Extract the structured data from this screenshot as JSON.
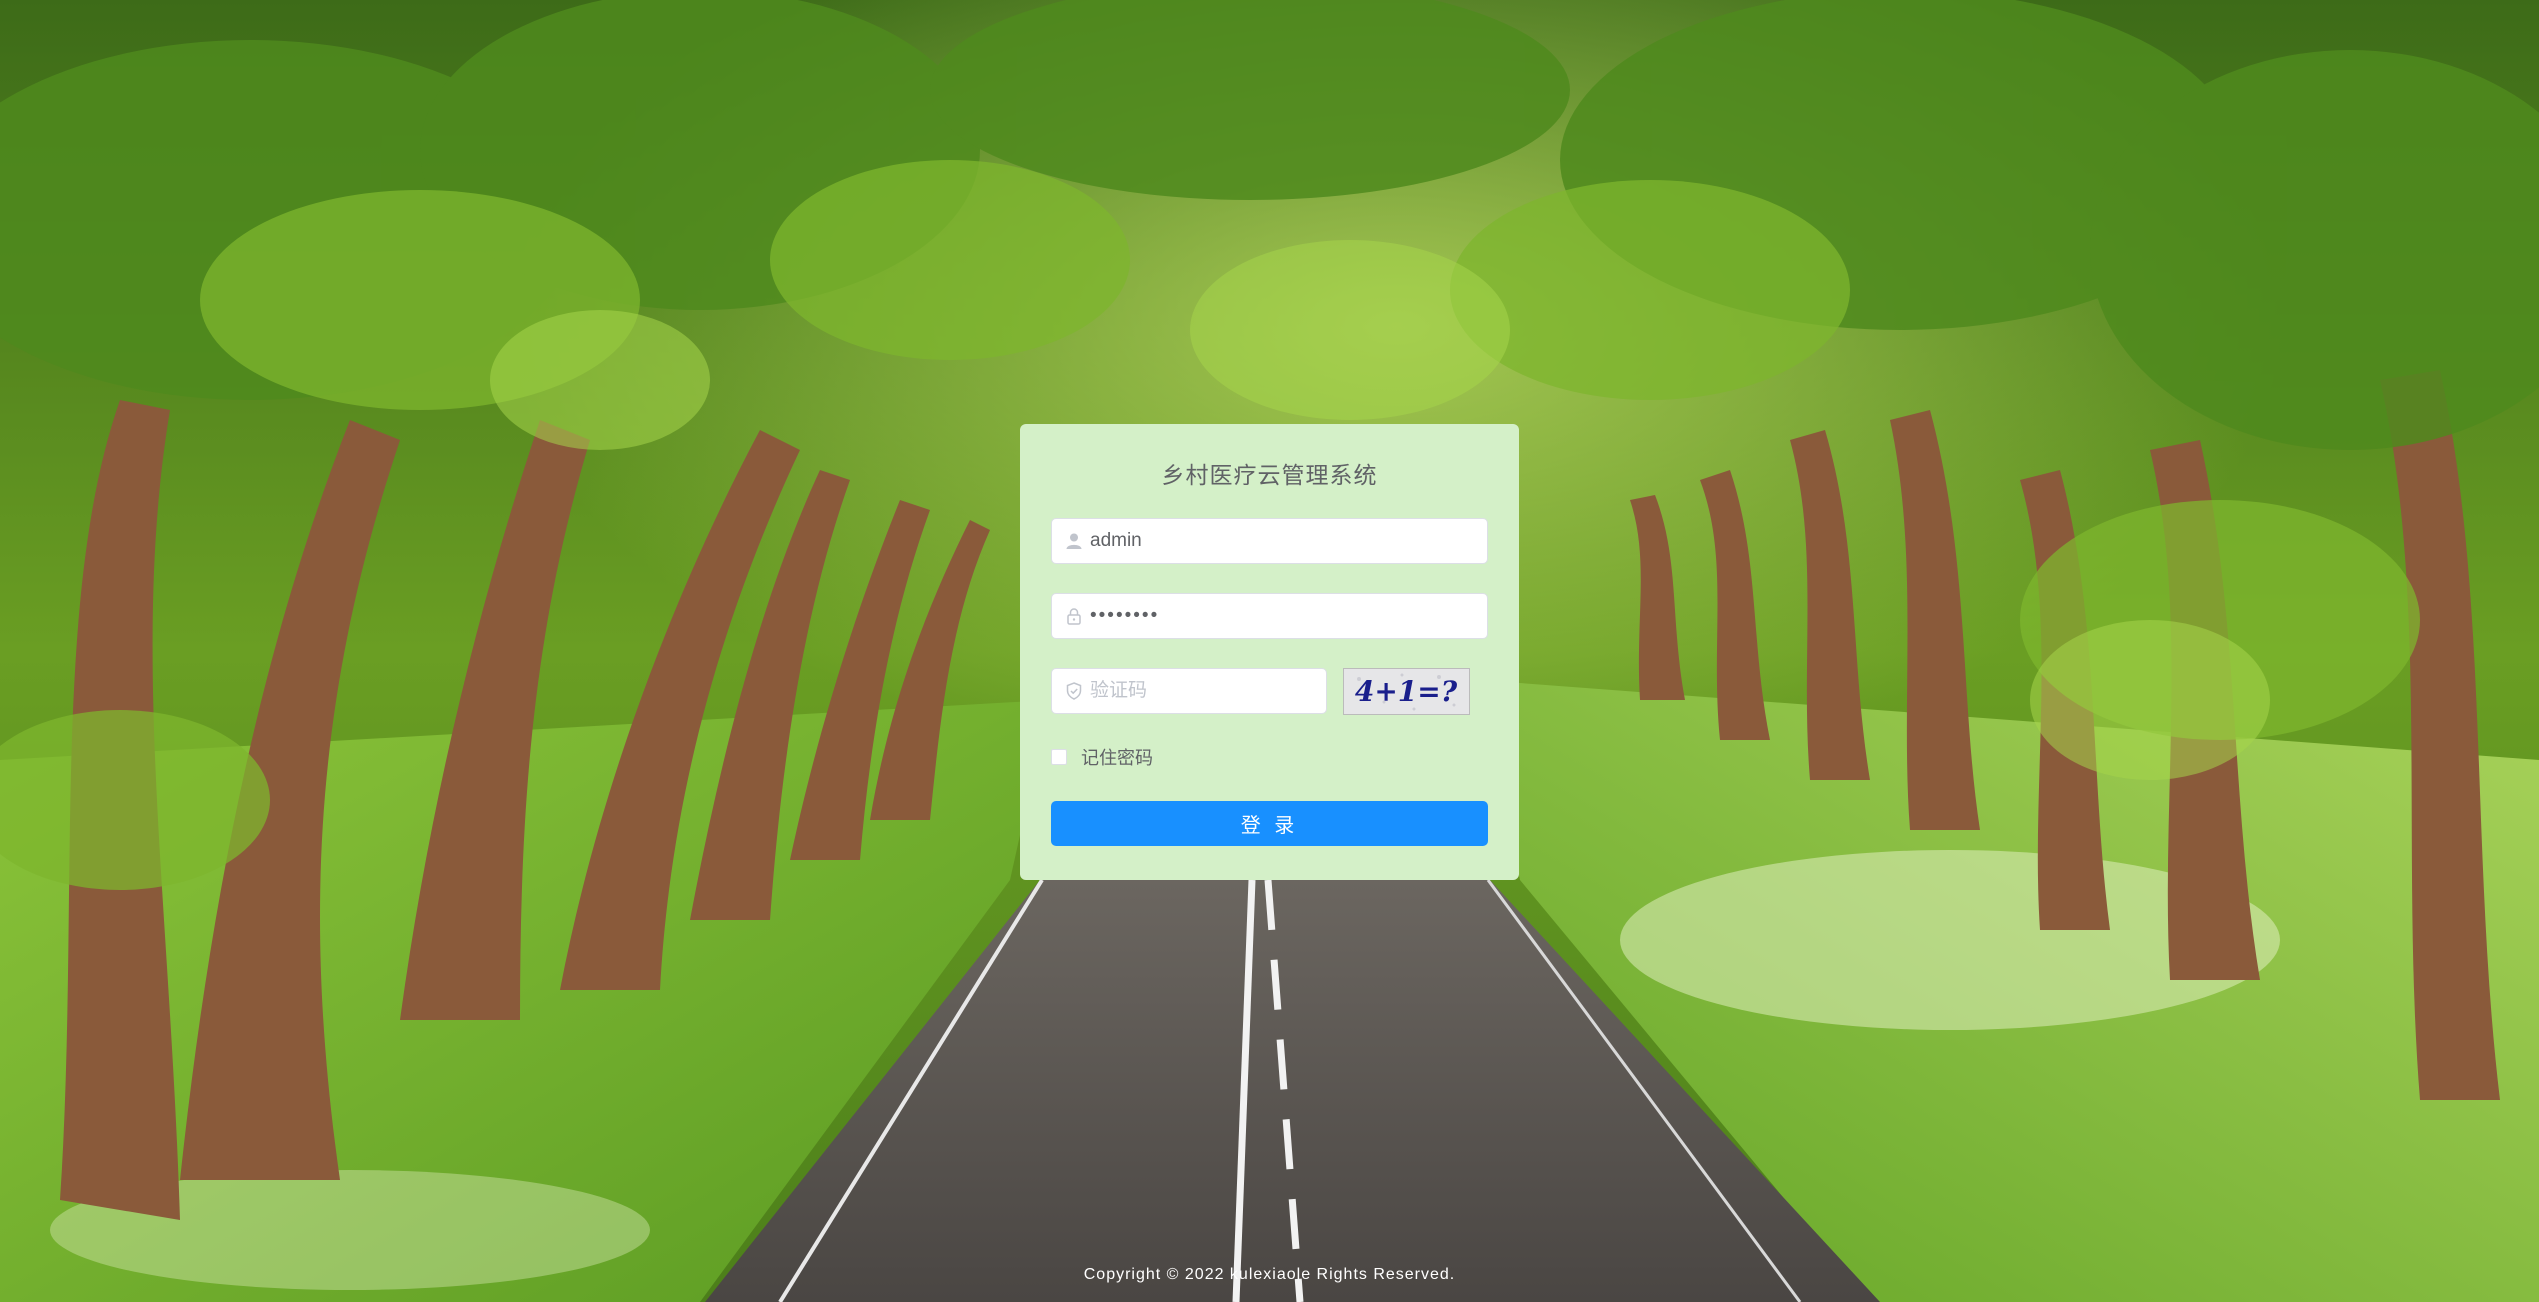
{
  "login": {
    "title": "乡村医疗云管理系统",
    "username_value": "admin",
    "username_icon": "user-icon",
    "password_value": "••••••••",
    "password_icon": "lock-icon",
    "code_placeholder": "验证码",
    "code_icon": "shield-check-icon",
    "captcha_text": "4+1=?",
    "remember_label": "记住密码",
    "submit_label": "登 录"
  },
  "footer": {
    "copyright": "Copyright © 2022 kulexiaole Rights Reserved."
  },
  "colors": {
    "card_bg": "#d4f0c8",
    "primary": "#1890ff",
    "text": "#606266"
  }
}
